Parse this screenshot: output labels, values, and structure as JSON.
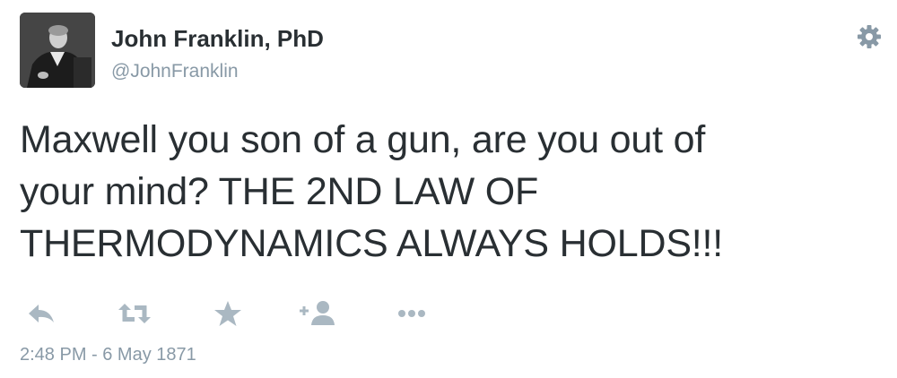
{
  "author": {
    "display_name": "John Franklin, PhD",
    "handle": "@JohnFranklin",
    "avatar_icon": "portrait-avatar"
  },
  "tweet": {
    "lines": [
      "Maxwell you son of a gun, are you out of",
      "your mind? THE 2ND LAW OF",
      "THERMODYNAMICS ALWAYS HOLDS!!!"
    ],
    "timestamp": "2:48 PM - 6 May 1871"
  },
  "actions": [
    {
      "name": "reply-icon"
    },
    {
      "name": "retweet-icon"
    },
    {
      "name": "favorite-star-icon"
    },
    {
      "name": "follow-add-user-icon"
    },
    {
      "name": "more-dots-icon"
    }
  ],
  "colors": {
    "text": "#292f33",
    "muted": "#8899a6",
    "icon": "#aab8c2",
    "gear": "#8899a6"
  }
}
